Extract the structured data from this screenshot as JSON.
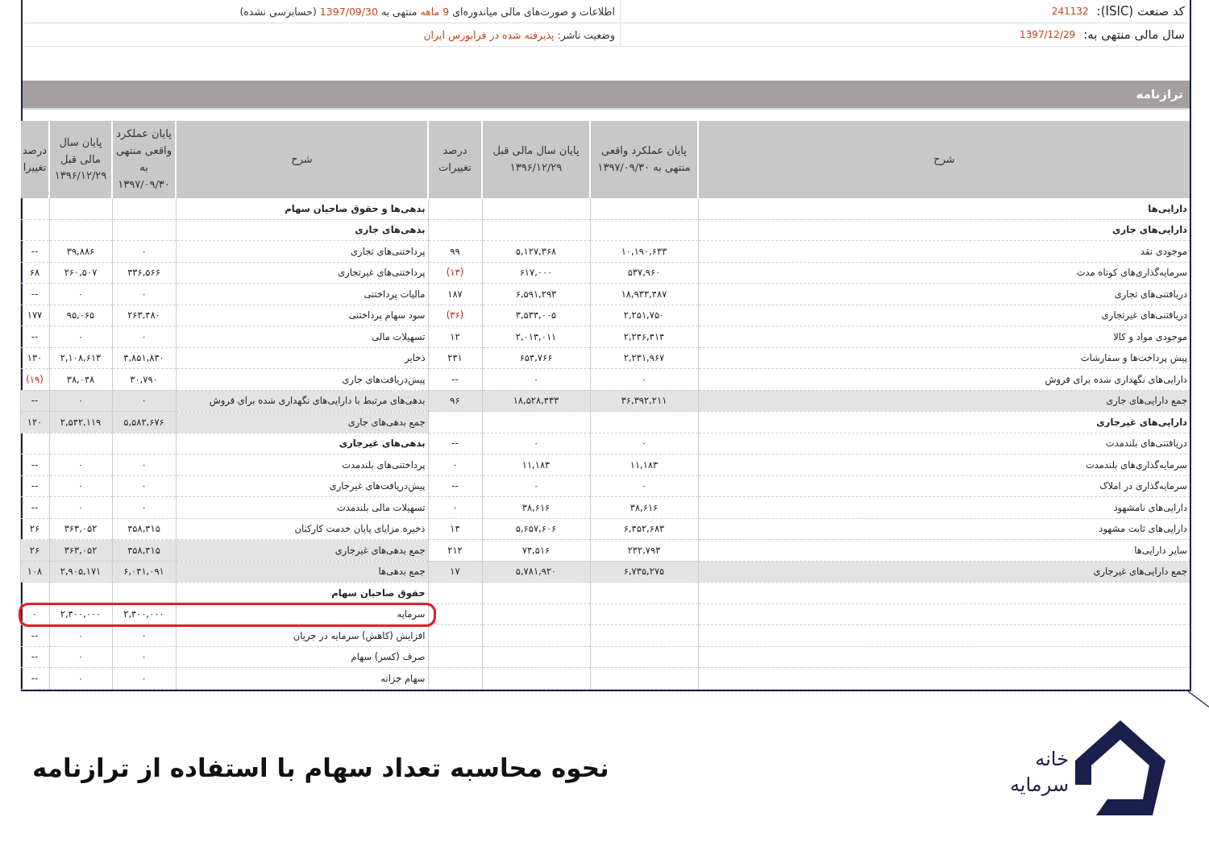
{
  "info_rows": [
    {
      "right": {
        "label": "کد صنعت (ISIC):",
        "value": "241132"
      },
      "left": [
        {
          "text": "اطلاعات و صورت‌های مالی میاندوره‌ای ",
          "highlight": false
        },
        {
          "text": "9 ماهه",
          "highlight": true
        },
        {
          "text": " منتهی به ",
          "highlight": false
        },
        {
          "text": "1397/09/30",
          "highlight": true
        },
        {
          "text": " (حسابرسی نشده)",
          "highlight": false
        }
      ]
    },
    {
      "right": {
        "label": "سال مالی منتهی به:",
        "value": "1397/12/29"
      },
      "left": [
        {
          "text": "وضعیت ناشر:",
          "highlight": false
        },
        {
          "text": "پذیرفته شده در فرابورس ایران",
          "highlight": true
        }
      ]
    }
  ],
  "section_title": "ترازنامه",
  "table": {
    "columns_right": [
      "شرح",
      "پایان عملکرد واقعی منتهی به ۱۳۹۷/۰۹/۳۰",
      "پایان سال مالی قبل ۱۳۹۶/۱۲/۲۹",
      "درصد تغییرات"
    ],
    "columns_left": [
      "شرح",
      "پایان عملکرد واقعی منتهی به ۱۳۹۷/۰۹/۳۰",
      "پایان سال مالی قبل ۱۳۹۶/۱۲/۲۹",
      "درصد تغییرا"
    ],
    "rows": [
      {
        "right": {
          "kind": "heading",
          "label": "دارایی‌ها",
          "shaded": false
        },
        "left": {
          "kind": "heading",
          "label": "بدهی‌ها و حقوق صاحبان سهام",
          "shaded": false
        }
      },
      {
        "right": {
          "kind": "heading",
          "label": "دارایی‌های جاری",
          "shaded": false
        },
        "left": {
          "kind": "heading",
          "label": "بدهی‌های جاری",
          "shaded": false
        }
      },
      {
        "right": {
          "kind": "item",
          "label": "موجودی نقد",
          "current": "۱۰,۱۹۰,۶۳۳",
          "previous": "۵,۱۲۷,۳۶۸",
          "change": "۹۹",
          "negative": false,
          "shaded": false
        },
        "left": {
          "kind": "item",
          "label": "پرداختنی‌های تجاری",
          "current": "۰",
          "previous": "۳۹,۸۸۶",
          "change": "--",
          "negative": false,
          "shaded": false
        }
      },
      {
        "right": {
          "kind": "item",
          "label": "سرمایه‌گذاری‌های کوتاه مدت",
          "current": "۵۳۷,۹۶۰",
          "previous": "۶۱۷,۰۰۰",
          "change": "(۱۳)",
          "negative": true,
          "shaded": false
        },
        "left": {
          "kind": "item",
          "label": "پرداختنی‌های غیرتجاری",
          "current": "۴۳۶,۵۶۶",
          "previous": "۲۶۰,۵۰۷",
          "change": "۶۸",
          "negative": false,
          "shaded": false
        }
      },
      {
        "right": {
          "kind": "item",
          "label": "دریافتنی‌های تجاری",
          "current": "۱۸,۹۳۳,۴۸۷",
          "previous": "۶,۵۹۱,۲۹۳",
          "change": "۱۸۷",
          "negative": false,
          "shaded": false
        },
        "left": {
          "kind": "item",
          "label": "مالیات پرداختنی",
          "current": "۰",
          "previous": "۰",
          "change": "--",
          "negative": false,
          "shaded": false
        }
      },
      {
        "right": {
          "kind": "item",
          "label": "دریافتنی‌های غیرتجاری",
          "current": "۲,۲۵۱,۷۵۰",
          "previous": "۳,۵۳۴,۰۰۵",
          "change": "(۳۶)",
          "negative": true,
          "shaded": false
        },
        "left": {
          "kind": "item",
          "label": "سود سهام پرداختنی",
          "current": "۲۶۳,۴۸۰",
          "previous": "۹۵,۰۶۵",
          "change": "۱۷۷",
          "negative": false,
          "shaded": false
        }
      },
      {
        "right": {
          "kind": "item",
          "label": "موجودی مواد و کالا",
          "current": "۲,۲۴۶,۴۱۴",
          "previous": "۲,۰۱۴,۰۱۱",
          "change": "۱۲",
          "negative": false,
          "shaded": false
        },
        "left": {
          "kind": "item",
          "label": "تسهیلات مالی",
          "current": "۰",
          "previous": "۰",
          "change": "--",
          "negative": false,
          "shaded": false
        }
      },
      {
        "right": {
          "kind": "item",
          "label": "پیش پرداخت‌ها و سفارشات",
          "current": "۲,۲۳۱,۹۶۷",
          "previous": "۶۵۴,۷۶۶",
          "change": "۲۴۱",
          "negative": false,
          "shaded": false
        },
        "left": {
          "kind": "item",
          "label": "ذخایر",
          "current": "۴,۸۵۱,۸۴۰",
          "previous": "۲,۱۰۸,۶۱۳",
          "change": "۱۳۰",
          "negative": false,
          "shaded": false
        }
      },
      {
        "right": {
          "kind": "item",
          "label": "دارایی‌های نگهداری شده برای فروش",
          "current": "۰",
          "previous": "۰",
          "change": "--",
          "negative": false,
          "shaded": false
        },
        "left": {
          "kind": "item",
          "label": "پیش‌دریافت‌های جاری",
          "current": "۳۰,۷۹۰",
          "previous": "۳۸,۰۴۸",
          "change": "(۱۹)",
          "negative": true,
          "shaded": false
        }
      },
      {
        "right": {
          "kind": "item",
          "label": "جمع دارایی‌های جاری",
          "current": "۳۶,۳۹۲,۲۱۱",
          "previous": "۱۸,۵۲۸,۴۳۳",
          "change": "۹۶",
          "negative": false,
          "shaded": true
        },
        "left": {
          "kind": "item",
          "label": "بدهی‌های مرتبط با دارایی‌های نگهداری شده برای فروش",
          "current": "۰",
          "previous": "۰",
          "change": "--",
          "negative": false,
          "shaded": true
        }
      },
      {
        "right": {
          "kind": "heading",
          "label": "دارایی‌های غیرجاری",
          "shaded": false
        },
        "left": {
          "kind": "item",
          "label": "جمع بدهی‌های جاری",
          "current": "۵,۵۸۲,۶۷۶",
          "previous": "۲,۵۴۲,۱۱۹",
          "change": "۱۲۰",
          "negative": false,
          "shaded": true
        }
      },
      {
        "right": {
          "kind": "item",
          "label": "دریافتنی‌های بلندمدت",
          "current": "۰",
          "previous": "۰",
          "change": "--",
          "negative": false,
          "shaded": false
        },
        "left": {
          "kind": "heading",
          "label": "بدهی‌های غیرجاری",
          "shaded": false
        }
      },
      {
        "right": {
          "kind": "item",
          "label": "سرمایه‌گذاری‌های بلندمدت",
          "current": "۱۱,۱۸۳",
          "previous": "۱۱,۱۸۳",
          "change": "۰",
          "negative": false,
          "shaded": false
        },
        "left": {
          "kind": "item",
          "label": "پرداختنی‌های بلندمدت",
          "current": "۰",
          "previous": "۰",
          "change": "--",
          "negative": false,
          "shaded": false
        }
      },
      {
        "right": {
          "kind": "item",
          "label": "سرمایه‌گذاری در املاک",
          "current": "۰",
          "previous": "۰",
          "change": "--",
          "negative": false,
          "shaded": false
        },
        "left": {
          "kind": "item",
          "label": "پیش‌دریافت‌های غیرجاری",
          "current": "۰",
          "previous": "۰",
          "change": "--",
          "negative": false,
          "shaded": false
        }
      },
      {
        "right": {
          "kind": "item",
          "label": "دارایی‌های نامشهود",
          "current": "۳۸,۶۱۶",
          "previous": "۳۸,۶۱۶",
          "change": "۰",
          "negative": false,
          "shaded": false
        },
        "left": {
          "kind": "item",
          "label": "تسهیلات مالی بلندمدت",
          "current": "۰",
          "previous": "۰",
          "change": "--",
          "negative": false,
          "shaded": false
        }
      },
      {
        "right": {
          "kind": "item",
          "label": "دارایی‌های ثابت مشهود",
          "current": "۶,۴۵۲,۶۸۳",
          "previous": "۵,۶۵۷,۶۰۶",
          "change": "۱۴",
          "negative": false,
          "shaded": false
        },
        "left": {
          "kind": "item",
          "label": "ذخیره مزایای پایان خدمت کارکنان",
          "current": "۴۵۸,۴۱۵",
          "previous": "۳۶۳,۰۵۲",
          "change": "۲۶",
          "negative": false,
          "shaded": false
        }
      },
      {
        "right": {
          "kind": "item",
          "label": "سایر دارایی‌ها",
          "current": "۲۳۲,۷۹۳",
          "previous": "۷۴,۵۱۶",
          "change": "۲۱۲",
          "negative": false,
          "shaded": false
        },
        "left": {
          "kind": "item",
          "label": "جمع بدهی‌های غیرجاری",
          "current": "۴۵۸,۴۱۵",
          "previous": "۳۶۳,۰۵۲",
          "change": "۲۶",
          "negative": false,
          "shaded": true
        }
      },
      {
        "right": {
          "kind": "item",
          "label": "جمع دارایی‌های غیرجاری",
          "current": "۶,۷۳۵,۲۷۵",
          "previous": "۵,۷۸۱,۹۲۰",
          "change": "۱۷",
          "negative": false,
          "shaded": true
        },
        "left": {
          "kind": "item",
          "label": "جمع بدهی‌ها",
          "current": "۶,۰۴۱,۰۹۱",
          "previous": "۲,۹۰۵,۱۷۱",
          "change": "۱۰۸",
          "negative": false,
          "shaded": true
        }
      },
      {
        "left": {
          "kind": "heading",
          "label": "حقوق صاحبان سهام",
          "shaded": false
        }
      },
      {
        "left": {
          "kind": "item",
          "label": "سرمایه",
          "current": "۲,۴۰۰,۰۰۰",
          "previous": "۲,۴۰۰,۰۰۰",
          "change": "۰",
          "negative": false,
          "shaded": false,
          "circled": true
        }
      },
      {
        "left": {
          "kind": "item",
          "label": "افزایش (کاهش) سرمایه در جریان",
          "current": "۰",
          "previous": "۰",
          "change": "--",
          "negative": false,
          "shaded": false
        }
      },
      {
        "left": {
          "kind": "item",
          "label": "صرف (کسر) سهام",
          "current": "۰",
          "previous": "۰",
          "change": "--",
          "negative": false,
          "shaded": false
        }
      },
      {
        "left": {
          "kind": "item",
          "label": "سهام خزانه",
          "current": "۰",
          "previous": "۰",
          "change": "--",
          "negative": false,
          "shaded": false
        }
      }
    ]
  },
  "banner": {
    "title": "نحوه محاسبه تعداد سهام با استفاده از ترازنامه",
    "brand_top": "خانه",
    "brand_bottom": "سرمایه"
  }
}
